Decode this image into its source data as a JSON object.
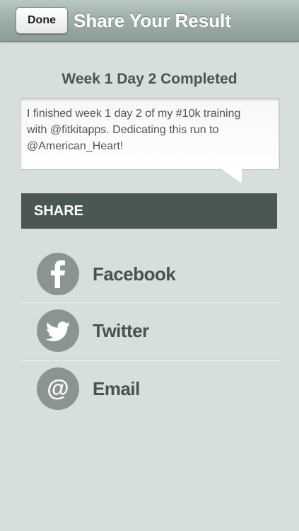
{
  "navbar": {
    "done_label": "Done",
    "title": "Share Your Result"
  },
  "completed_title": "Week 1 Day 2 Completed",
  "message": {
    "text": "I finished week 1 day 2 of my #10k training\nwith @fitkitapps. Dedicating this run to\n@American_Heart!"
  },
  "share": {
    "header": "SHARE",
    "items": [
      {
        "label": "Facebook",
        "icon": "facebook-icon"
      },
      {
        "label": "Twitter",
        "icon": "twitter-bird-icon"
      },
      {
        "label": "Email",
        "icon": "at-sign-icon"
      }
    ]
  },
  "colors": {
    "background": "#d6dfdd",
    "share_header": "#4b5754",
    "icon_circle": "#8a9592"
  }
}
